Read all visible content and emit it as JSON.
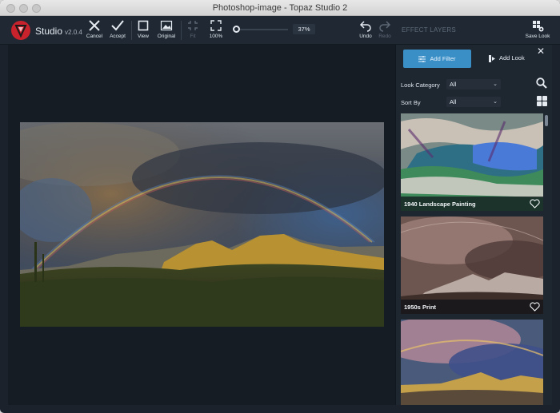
{
  "window": {
    "title": "Photoshop-image - Topaz Studio 2"
  },
  "app": {
    "name": "Studio",
    "version": "v2.0.4"
  },
  "toolbar": {
    "cancel": "Cancel",
    "accept": "Accept",
    "view": "View",
    "original": "Original",
    "fit": "Fit",
    "zoom100": "100%",
    "zoom_value": "37%",
    "undo": "Undo",
    "redo": "Redo",
    "save_look": "Save Look"
  },
  "panel": {
    "title": "EFFECT LAYERS",
    "add_filter": "Add Filter",
    "add_look": "Add Look",
    "look_category_label": "Look Category",
    "look_category_value": "All",
    "sort_by_label": "Sort By",
    "sort_by_value": "All",
    "looks": [
      {
        "name": "1940 Landscape Painting"
      },
      {
        "name": "1950s Print"
      },
      {
        "name": ""
      }
    ]
  },
  "colors": {
    "accent": "#3b8fc7",
    "logo": "#c8232c",
    "background": "#1b222c"
  }
}
